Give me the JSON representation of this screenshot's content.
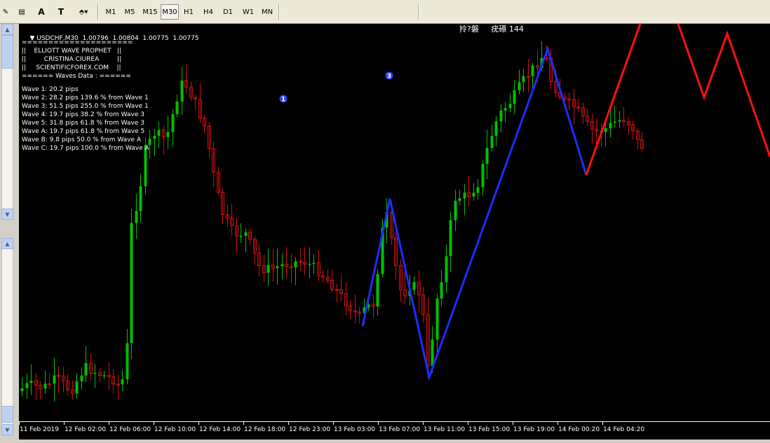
{
  "toolbar": {
    "tools": [
      {
        "name": "fibonacci-tool",
        "glyph": "✎"
      },
      {
        "name": "fibonacci-fan-tool",
        "glyph": "▤"
      },
      {
        "name": "text-tool",
        "glyph": "A"
      },
      {
        "name": "text-label-tool",
        "glyph": "T"
      },
      {
        "name": "arrows-tool",
        "glyph": "⬘▾"
      }
    ],
    "timeframes": [
      "M1",
      "M5",
      "M15",
      "M30",
      "H1",
      "H4",
      "D1",
      "W1",
      "MN"
    ],
    "active_timeframe": "M30"
  },
  "chart": {
    "header": "USDCHF,M30  1.00796  1.00804  1.00775  1.00775",
    "garbled_label": "拎?磐     疣礤 144",
    "ea_box": [
      "=====================",
      "||    ELLIOTT WAVE PROPHET   ||",
      "||         CRISTINA CIUREA         ||",
      "||     SCIENTIFICFOREX.COM    ||",
      "====== Waves Data : ======"
    ],
    "waves": [
      "Wave 1: 20.2 pips",
      "Wave 2: 28.2 pips 139.6 % from Wave 1",
      "Wave 3: 51.5 pips 255.0 % from Wave 1",
      "Wave 4: 19.7 pips 38.2 % from Wave 3",
      "Wave 5: 31.8 pips 61.8 % from Wave 3",
      "Wave A: 19.7 pips 61.8 % from Wave 5",
      "Wave B: 9.8 pips 50.0 % from Wave A",
      "Wave C: 19.7 pips 100.0 % from Wave A"
    ],
    "markers": [
      "1",
      "3"
    ],
    "x_axis_labels": [
      "11 Feb 2019",
      "12 Feb 02:00",
      "12 Feb 06:00",
      "12 Feb 10:00",
      "12 Feb 14:00",
      "12 Feb 18:00",
      "12 Feb 23:00",
      "13 Feb 03:00",
      "13 Feb 07:00",
      "13 Feb 11:00",
      "13 Feb 15:00",
      "13 Feb 19:00",
      "14 Feb 00:20",
      "14 Feb 04:20"
    ],
    "colors": {
      "bull": "#00c000",
      "bear": "#d01010",
      "wave_line": "#1f2bff",
      "projection": "#ff1010",
      "background": "#000000"
    }
  }
}
